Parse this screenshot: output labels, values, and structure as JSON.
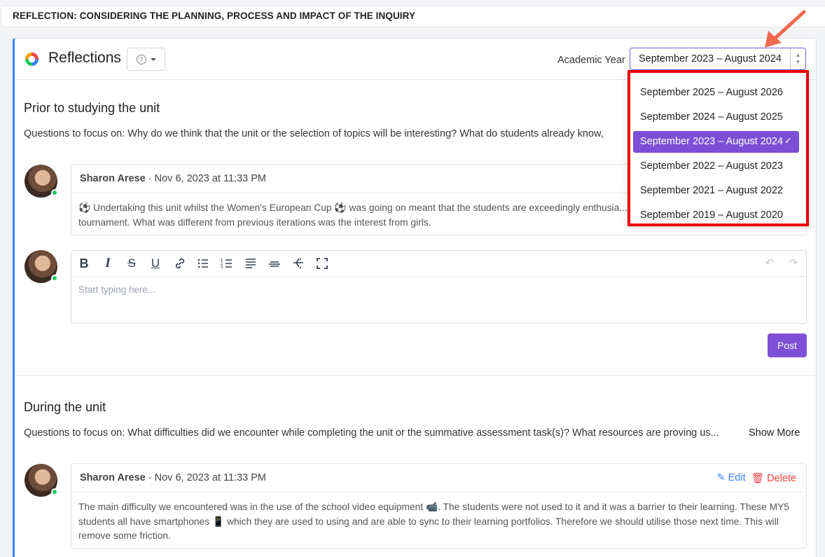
{
  "page_header": "REFLECTION: CONSIDERING THE PLANNING, PROCESS AND IMPACT OF THE INQUIRY",
  "panel": {
    "title": "Reflections",
    "help_icon": "?",
    "academic_year_label": "Academic Year",
    "academic_year_value": "September 2023 – August 2024"
  },
  "dropdown": {
    "options": [
      "September 2025 – August 2026",
      "September 2024 – August 2025",
      "September 2023 – August 2024",
      "September 2022 – August 2023",
      "September 2021 – August 2022",
      "September 2019 – August 2020"
    ],
    "selected_index": 2,
    "check": "✓"
  },
  "section1": {
    "title": "Prior to studying the unit",
    "description": "Questions to focus on: Why do we think that the unit or the selection of topics will be interesting? What do students already know,",
    "comment": {
      "author": "Sharon Arese",
      "date": " · Nov 6, 2023 at 11:33 PM",
      "body": "⚽ Undertaking this unit whilst the Women's European Cup ⚽ was going on meant that the students are exceedingly enthusia... to have this unit during a major tournament. What was different from previous iterations was the interest from girls."
    },
    "editor": {
      "placeholder": "Start typing here...",
      "post_label": "Post"
    }
  },
  "section2": {
    "title": "During the unit",
    "description": "Questions to focus on: What difficulties did we encounter while completing the unit or the summative assessment task(s)? What resources are proving us...",
    "show_more": "Show More",
    "comment": {
      "author": "Sharon Arese",
      "date": " · Nov 6, 2023 at 11:33 PM",
      "edit_label": "Edit",
      "delete_label": "Delete",
      "body": "The main difficulty we encountered was in the use of the school video equipment 📹. The students were not used to it and it was a barrier to their learning. These MY5 students all have smartphones 📱 which they are used to using and are able to sync to their learning portfolios. Therefore we should utilise those next time. This will remove some friction."
    }
  },
  "colors": {
    "accent": "#7c4fd6",
    "left_border": "#3b82f6",
    "highlight_box": "#e00000",
    "arrow": "#f06a4f",
    "online_dot": "#22c55e"
  }
}
